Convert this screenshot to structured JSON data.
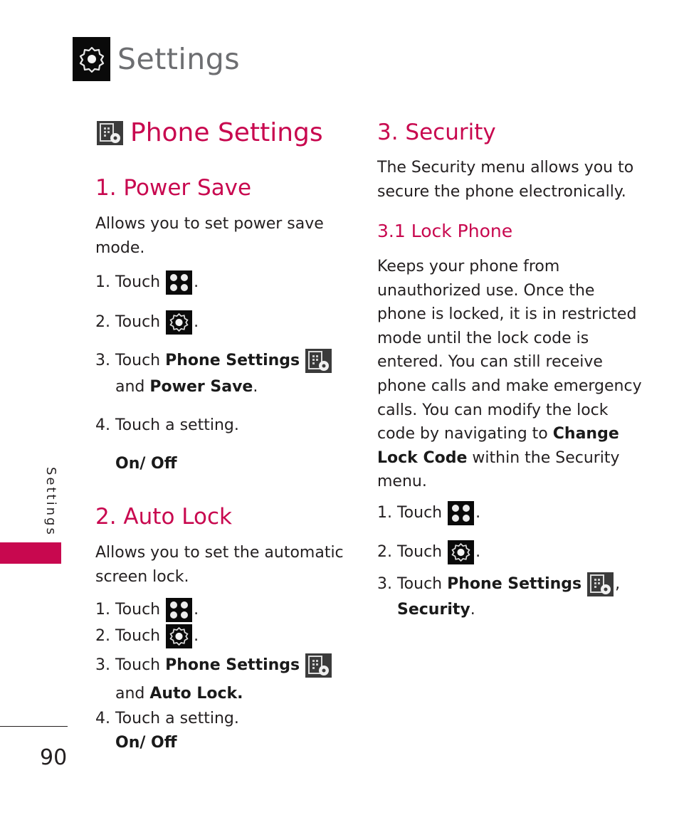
{
  "header": {
    "title": "Settings",
    "icon": "gear-icon"
  },
  "side_tab": {
    "label": "Settings",
    "accent_color": "#c8084f"
  },
  "footer": {
    "page_number": "90"
  },
  "left_column": {
    "heading": "Phone Settings",
    "heading_icon": "phone-settings-icon",
    "power_save": {
      "title": "1. Power Save",
      "intro_1": "Allows you to set power save",
      "intro_2": "mode.",
      "step1": "1. Touch",
      "step2": "2. Touch",
      "step3_prefix": "3. Touch",
      "step3_bold": "Phone Settings",
      "step3b_prefix": "and",
      "step3b_bold": "Power Save",
      "step3b_suffix": ".",
      "step4": "4. Touch a setting.",
      "option": "On/ Off"
    },
    "auto_lock": {
      "title": "2. Auto Lock",
      "intro_1": "Allows you to set the automatic",
      "intro_2": "screen lock.",
      "step1": "1. Touch",
      "step2": "2. Touch",
      "step3_prefix": "3. Touch",
      "step3_bold": "Phone Settings",
      "step3b_prefix": "and",
      "step3b_bold": "Auto Lock.",
      "step4": "4. Touch a setting.",
      "option": "On/ Off"
    }
  },
  "right_column": {
    "security": {
      "title": "3. Security",
      "intro_1": "The Security menu allows you to",
      "intro_2": "secure the phone electronically."
    },
    "lock_phone": {
      "title": "3.1 Lock Phone",
      "lines": [
        "Keeps your phone from",
        "unauthorized use. Once the",
        "phone is locked, it is in restricted",
        "mode until the lock code is",
        "entered. You can still receive",
        "phone calls and make emergency",
        "calls. You can modify the lock"
      ],
      "line8_prefix": "code by navigating to",
      "line8_bold": "Change",
      "line9_bold": "Lock Code",
      "line9_suffix": "within the Security",
      "line10": "menu.",
      "step1": "1. Touch",
      "step2": "2. Touch",
      "step3_prefix": "3. Touch",
      "step3_bold": "Phone Settings",
      "step3_suffix": ",",
      "step3b_bold": "Security",
      "step3b_suffix": "."
    }
  },
  "punct": {
    "period": "."
  }
}
